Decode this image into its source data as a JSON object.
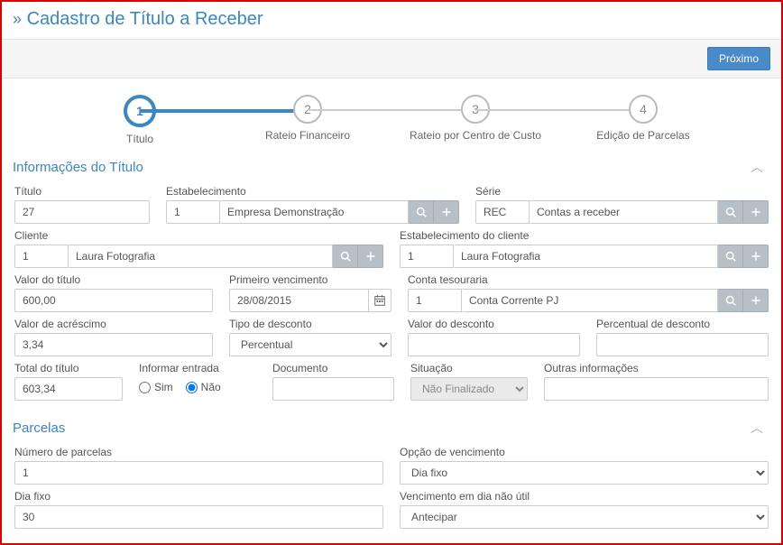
{
  "page": {
    "title": "Cadastro de Título a Receber"
  },
  "toolbar": {
    "next": "Próximo"
  },
  "stepper": [
    {
      "num": "1",
      "label": "Título"
    },
    {
      "num": "2",
      "label": "Rateio Financeiro"
    },
    {
      "num": "3",
      "label": "Rateio por Centro de Custo"
    },
    {
      "num": "4",
      "label": "Edição de Parcelas"
    }
  ],
  "sections": {
    "info": {
      "title": "Informações do Título"
    },
    "parcelas": {
      "title": "Parcelas"
    }
  },
  "form": {
    "titulo": {
      "label": "Título",
      "value": "27"
    },
    "estabelecimento": {
      "label": "Estabelecimento",
      "id": "1",
      "name": "Empresa Demonstração"
    },
    "serie": {
      "label": "Série",
      "id": "REC",
      "name": "Contas a receber"
    },
    "cliente": {
      "label": "Cliente",
      "id": "1",
      "name": "Laura Fotografia"
    },
    "estab_cliente": {
      "label": "Estabelecimento do cliente",
      "id": "1",
      "name": "Laura Fotografia"
    },
    "valor_titulo": {
      "label": "Valor do título",
      "value": "600,00"
    },
    "primeiro_venc": {
      "label": "Primeiro vencimento",
      "value": "28/08/2015"
    },
    "conta_tes": {
      "label": "Conta tesouraria",
      "id": "1",
      "name": "Conta Corrente PJ"
    },
    "valor_acrescimo": {
      "label": "Valor de acréscimo",
      "value": "3,34"
    },
    "tipo_desconto": {
      "label": "Tipo de desconto",
      "value": "Percentual"
    },
    "valor_desconto": {
      "label": "Valor do desconto",
      "value": ""
    },
    "percentual_desconto": {
      "label": "Percentual de desconto",
      "value": ""
    },
    "total_titulo": {
      "label": "Total do título",
      "value": "603,34"
    },
    "informar_entrada": {
      "label": "Informar entrada",
      "sim": "Sim",
      "nao": "Não",
      "selected": "nao"
    },
    "documento": {
      "label": "Documento",
      "value": ""
    },
    "situacao": {
      "label": "Situação",
      "value": "Não Finalizado"
    },
    "outras_info": {
      "label": "Outras informações",
      "value": ""
    },
    "num_parcelas": {
      "label": "Número de parcelas",
      "value": "1"
    },
    "opcao_venc": {
      "label": "Opção de vencimento",
      "value": "Dia fixo"
    },
    "dia_fixo": {
      "label": "Dia fixo",
      "value": "30"
    },
    "venc_nao_util": {
      "label": "Vencimento em dia não útil",
      "value": "Antecipar"
    }
  }
}
